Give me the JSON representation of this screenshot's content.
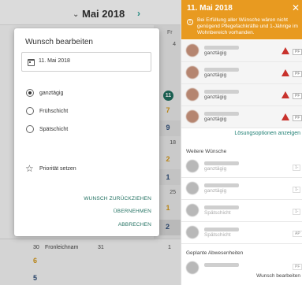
{
  "calendar": {
    "month_title": "Mai 2018",
    "prev_icon": "chevron-down-icon",
    "next_icon": "chevron-right-icon",
    "weekday_fr": "Fr",
    "cells": {
      "fr_4": "4",
      "fr_11_badge": "11",
      "fr_7": "7",
      "fr_9": "9",
      "fr_18": "18",
      "fr_2a": "2",
      "fr_1a": "1",
      "fr_25": "25",
      "fr_1b": "1",
      "fr_2b": "2"
    },
    "bottom_row": {
      "day_30": "30",
      "holiday": "Fronleichnam",
      "day_31": "31",
      "day_1": "1",
      "count_gold": "6",
      "count_blue": "5"
    },
    "colors": {
      "gold": "#d79a1a",
      "blue": "#2f4f7a",
      "teal": "#1f6f5f",
      "red": "#c8322c"
    }
  },
  "panel": {
    "title": "11. Mai 2018",
    "close_icon": "close-icon",
    "warning": "Bei Erfüllung aller Wünsche wären nicht genügend Pflegefachkräfte und 1-Jährige im Wohnbereich vorhanden.",
    "header_color": "#e89a20",
    "warn_rows": [
      {
        "shift": "ganztägig",
        "tag": "PF"
      },
      {
        "shift": "ganztägig",
        "tag": "PF"
      },
      {
        "shift": "ganztägig",
        "tag": "PF"
      },
      {
        "shift": "ganztägig",
        "tag": "PF"
      }
    ],
    "solutions_link": "Lösungsoptionen anzeigen",
    "section_further": "Weitere Wünsche",
    "further_rows": [
      {
        "shift": "ganztägig",
        "tag": "1-"
      },
      {
        "shift": "ganztägig",
        "tag": "1-"
      },
      {
        "shift": "Spätschicht",
        "tag": "1-"
      },
      {
        "shift": "Spätschicht",
        "tag": "AP"
      }
    ],
    "section_absences": "Geplante Abwesenheiten",
    "absence_tag": "PF",
    "footer_button": "Wunsch bearbeiten"
  },
  "modal": {
    "title": "Wunsch bearbeiten",
    "date_value": "11. Mai 2018",
    "options": [
      {
        "label": "ganztägig",
        "checked": true
      },
      {
        "label": "Frühschicht",
        "checked": false
      },
      {
        "label": "Spätschicht",
        "checked": false
      }
    ],
    "priority_label": "Priorität setzen",
    "withdraw_label": "WUNSCH ZURÜCKZIEHEN",
    "accept_label": "ÜBERNEHMEN",
    "cancel_label": "ABBRECHEN"
  }
}
